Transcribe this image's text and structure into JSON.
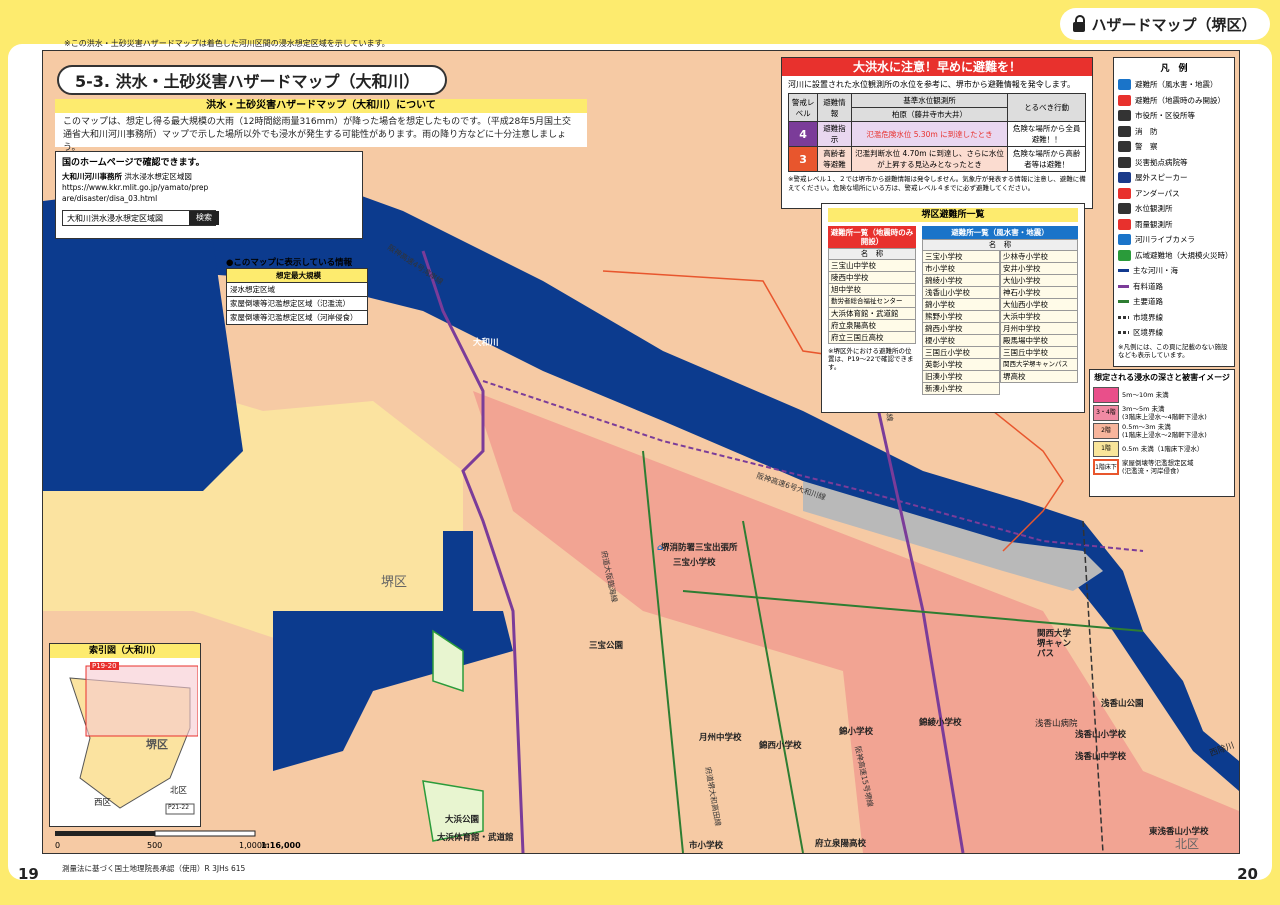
{
  "header": {
    "note": "※この洪水・土砂災害ハザードマップは着色した河川区間の浸水想定区域を示しています。",
    "section_title": "ハザードマップ（堺区）",
    "page_left": "19",
    "page_right": "20"
  },
  "map_title": "5-3. 洪水・土砂災害ハザードマップ（大和川）",
  "about": {
    "heading": "洪水・土砂災害ハザードマップ（大和川）について",
    "text": "このマップは、想定し得る最大規模の大雨（12時間総雨量316mm）が降った場合を想定したものです。（平成28年5月国土交通省大和川河川事務所）マップで示した場所以外でも浸水が発生する可能性があります。雨の降り方などに十分注意しましょう。"
  },
  "home": {
    "title": "国のホームページで確認できます。",
    "office": "大和川河川事務所",
    "office_sub": "洪水浸水想定区域図",
    "url": "https://www.kkr.mlit.go.jp/yamato/prepare/disaster/disa_03.html",
    "search_text": "大和川洪水浸水想定区域図",
    "search_button": "検索"
  },
  "map_info": {
    "heading": "●このマップに表示している情報",
    "rows": [
      "想定最大規模",
      "浸水想定区域",
      "家屋倒壊等氾濫想定区域（氾濫流）",
      "家屋倒壊等氾濫想定区域（河岸侵食）"
    ]
  },
  "alert": {
    "heading": "大洪水に注意！早めに避難を！",
    "text": "河川に設置された水位観測所の水位を参考に、堺市から避難情報を発令します。",
    "col_level": "警戒レベル",
    "col_info": "避難情報",
    "col_station": "基準水位観測所",
    "col_station_sub": "柏原（藤井寺市大井）",
    "col_action": "とるべき行動",
    "rows": [
      {
        "level": "4",
        "info": "避難指示",
        "station": "氾濫危険水位 5.30m に到達したとき",
        "action": "危険な場所から全員避難！！"
      },
      {
        "level": "3",
        "info": "高齢者等避難",
        "station": "氾濫判断水位 4.70m に到達し、さらに水位が上昇する見込みとなったとき",
        "action": "危険な場所から高齢者等は避難！"
      }
    ],
    "note": "※警戒レベル１、２では堺市から避難情報は発令しません。気象庁が発表する情報に注意し、避難に備えてください。危険な場所にいる方は、警戒レベル４までに必ず避難してください。"
  },
  "shelters": {
    "heading": "堺区避難所一覧",
    "left_heading": "避難所一覧（地震時のみ開設）",
    "right_heading": "避難所一覧（風水害・地震）",
    "name_label": "名　称",
    "left": [
      "三宝山中学校",
      "陵西中学校",
      "旭中学校",
      "勤労者総合福祉センター",
      "大浜体育館・武道館",
      "府立泉陽高校",
      "府立三国丘高校"
    ],
    "left_note": "※堺区外における避難所の位置は、P19～22で確認できます。",
    "right_a": [
      "三宝小学校",
      "市小学校",
      "錦綾小学校",
      "浅香山小学校",
      "錦小学校",
      "熊野小学校",
      "錦西小学校",
      "榎小学校",
      "三国丘小学校",
      "英彰小学校",
      "旧湊小学校",
      "新湊小学校"
    ],
    "right_b": [
      "少林寺小学校",
      "安井小学校",
      "大仙小学校",
      "神石小学校",
      "大仙西小学校",
      "大浜中学校",
      "月州中学校",
      "殿馬場中学校",
      "三国丘中学校",
      "関西大学堺キャンパス",
      "堺高校"
    ]
  },
  "legend": {
    "heading": "凡　例",
    "items": [
      {
        "label": "避難所（風水害・地震）",
        "icon": "shelter-icon",
        "color": "#1a74c9"
      },
      {
        "label": "避難所（地震時のみ開設）",
        "icon": "quake-shelter-icon",
        "color": "#e8312d"
      },
      {
        "label": "市役所・区役所等",
        "icon": "city-hall-icon",
        "color": "#333333"
      },
      {
        "label": "消　防",
        "icon": "fire-station-icon",
        "color": "#333333"
      },
      {
        "label": "警　察",
        "icon": "police-icon",
        "color": "#333333"
      },
      {
        "label": "災害拠点病院等",
        "icon": "hospital-icon",
        "color": "#333333"
      },
      {
        "label": "屋外スピーカー",
        "icon": "speaker-icon",
        "color": "#1a3a8a"
      },
      {
        "label": "アンダーパス",
        "icon": "underpass-icon",
        "color": "#e8312d"
      },
      {
        "label": "水位観測所",
        "icon": "water-gauge-icon",
        "color": "#333333"
      },
      {
        "label": "雨量観測所",
        "icon": "rain-gauge-icon",
        "color": "#e8312d"
      },
      {
        "label": "河川ライブカメラ",
        "icon": "camera-icon",
        "color": "#1a74c9"
      },
      {
        "label": "広域避難地（大規模火災時）",
        "icon": "wide-area-icon",
        "color": "#2a9b3a"
      },
      {
        "label": "主な河川・海",
        "icon": "river-icon",
        "color": "#123a8f"
      },
      {
        "label": "有料道路",
        "icon": "toll-road-icon",
        "color": "#7b3c99"
      },
      {
        "label": "主要道路",
        "icon": "main-road-icon",
        "color": "#2e7d32"
      },
      {
        "label": "市境界線",
        "icon": "city-border-icon",
        "color": "#333333"
      },
      {
        "label": "区境界線",
        "icon": "ward-border-icon",
        "color": "#333333"
      }
    ],
    "note": "※凡例には、この頁に記載のない施設なども表示しています。"
  },
  "depth": {
    "heading": "想定される浸水の深さと被害イメージ",
    "rows": [
      {
        "label": "5m～10m 未満",
        "sub": "",
        "color": "#e94f8a"
      },
      {
        "label": "3m～5m 未満",
        "sub": "(3階床上浸水～4階軒下浸水)",
        "color": "#f08aa3",
        "tag": "3・4階"
      },
      {
        "label": "0.5m～3m 未満",
        "sub": "(1階床上浸水～2階軒下浸水)",
        "color": "#f7b59c",
        "tag": "2階"
      },
      {
        "label": "0.5m 未満（1階床下浸水）",
        "sub": "",
        "color": "#f9e59a",
        "tag": "1階"
      },
      {
        "label": "家屋倒壊等氾濫想定区域",
        "sub": "(氾濫流・河岸侵食)",
        "color": "#ffffff",
        "tag": "1階床下"
      }
    ]
  },
  "index_map": {
    "heading": "索引図（大和川）",
    "page_ref": "P19-20",
    "page_ref2": "P21-22",
    "ward": "堺区",
    "west": "西区",
    "north": "北区"
  },
  "scale": {
    "s0": "0",
    "s1": "500",
    "s2": "1,000m",
    "ratio": "1:16,000"
  },
  "credit": "測量法に基づく国土地理院長承認（使用）R 3JHs 615",
  "places": {
    "river": "大和川",
    "ward": "堺区",
    "north_ward": "北区",
    "expressway": "阪神高速4号湾岸線",
    "expressway6": "阪神高速6号大和川線",
    "sanpou_school": "三宝小学校",
    "fire_station": "堺消防署三宝出張所",
    "sanpou_park": "三宝公園",
    "kansai_univ": "関西大学 堺キャンパス",
    "asakayama_park": "浅香山公園",
    "asakayama_hospital": "浅香山病院",
    "asakayama_es": "浅香山小学校",
    "asakayama_jhs": "浅香山中学校",
    "kinryo_es": "錦綾小学校",
    "gesshu_jhs": "月州中学校",
    "kinsai_es": "錦西小学校",
    "nishiki_es": "錦小学校",
    "ohama_park": "大浜公園",
    "ohama_gym": "大浜体育館・武道館",
    "ichi_es": "市小学校",
    "senyo_hs": "府立泉陽高校",
    "east_asakayama_es": "東浅香山小学校",
    "nishijokegawa": "西除川",
    "road_sakai_ohama": "府道大阪臨海線",
    "road_15": "阪神高速15号堺線",
    "road_nankai": "南海本線",
    "road_yamatogawa": "府道堺大和高田線"
  }
}
